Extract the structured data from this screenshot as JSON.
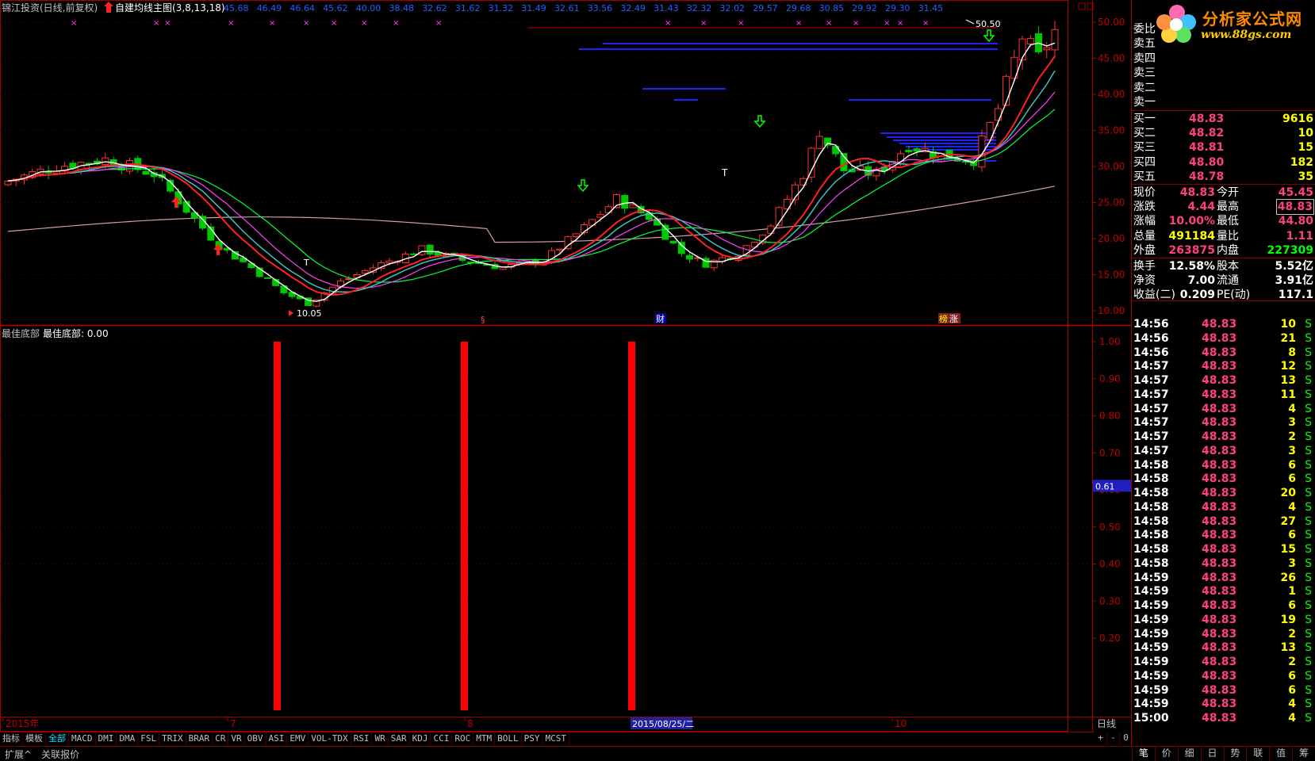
{
  "window": {
    "stock_title": "锦江投资(日线,前复权)",
    "indicator_title": "自建均线主图(3,8,13,18)",
    "ma_values": [
      "45.68",
      "46.49",
      "46.64",
      "45.62",
      "40.00",
      "38.48",
      "32.62",
      "31.62",
      "31.32",
      "31.49",
      "32.61",
      "33.56",
      "32.49",
      "31.43",
      "32.32",
      "32.02",
      "29.57",
      "29.68",
      "30.85",
      "29.92",
      "29.30",
      "31.45"
    ]
  },
  "main_chart": {
    "price_axis": [
      "50.00",
      "45.00",
      "40.00",
      "35.00",
      "30.00",
      "25.00",
      "20.00",
      "15.00",
      "10.00"
    ],
    "high_label": "50.50",
    "low_label": "10.05",
    "markers": {
      "s_mark": "§",
      "cai_mark": "财",
      "bang_mark": "榜",
      "zhang_mark": "涨",
      "t_mark": "T"
    },
    "colors": {
      "up": "#ff3232",
      "down": "#00c800",
      "ma3": "#ffffff",
      "ma8": "#ff2020",
      "ma13": "#ff40ff",
      "ma18": "#00ff40",
      "long_ma": "#d0a0a0",
      "cyan_ma": "#40c0c0"
    }
  },
  "sub_chart": {
    "title": "最佳底部",
    "value_label": "最佳底部: 0.00",
    "axis": [
      "1.00",
      "0.90",
      "0.80",
      "0.70",
      "0.60",
      "0.50",
      "0.40",
      "0.30",
      "0.20"
    ],
    "current_marker": "0.61",
    "signal_bars": 3
  },
  "time_axis": {
    "labels": [
      "2015年",
      "7",
      "8",
      "10"
    ],
    "cursor_date": "2015/08/25/二",
    "period": "日线"
  },
  "indicator_tabs": [
    "指标",
    "模板",
    "全部",
    "MACD",
    "DMI",
    "DMA",
    "FSL",
    "TRIX",
    "BRAR",
    "CR",
    "VR",
    "OBV",
    "ASI",
    "EMV",
    "VOL-TDX",
    "RSI",
    "WR",
    "SAR",
    "KDJ",
    "CCI",
    "ROC",
    "MTM",
    "BOLL",
    "PSY",
    "MCST"
  ],
  "tab_controls": [
    "+",
    "-",
    "0"
  ],
  "bottom_bar": [
    "扩展^",
    "关联报价"
  ],
  "logo": {
    "name": "分析家公式网",
    "url": "www.88gs.com"
  },
  "order_book": {
    "committee_label": "委比",
    "sells": [
      {
        "label": "卖五",
        "price": "",
        "vol": ""
      },
      {
        "label": "卖四",
        "price": "",
        "vol": ""
      },
      {
        "label": "卖三",
        "price": "",
        "vol": ""
      },
      {
        "label": "卖二",
        "price": "",
        "vol": ""
      },
      {
        "label": "卖一",
        "price": "",
        "vol": ""
      }
    ],
    "buys": [
      {
        "label": "买一",
        "price": "48.83",
        "vol": "9616"
      },
      {
        "label": "买二",
        "price": "48.82",
        "vol": "10"
      },
      {
        "label": "买三",
        "price": "48.81",
        "vol": "15"
      },
      {
        "label": "买四",
        "price": "48.80",
        "vol": "182"
      },
      {
        "label": "买五",
        "price": "48.78",
        "vol": "35"
      }
    ]
  },
  "quote": [
    {
      "l1": "现价",
      "v1": "48.83",
      "c1": "pink",
      "l2": "今开",
      "v2": "45.45",
      "c2": "pink"
    },
    {
      "l1": "涨跌",
      "v1": "4.44",
      "c1": "pink",
      "l2": "最高",
      "v2": "48.83",
      "c2": "pink"
    },
    {
      "l1": "涨幅",
      "v1": "10.00%",
      "c1": "pink",
      "l2": "最低",
      "v2": "44.80",
      "c2": "pink"
    },
    {
      "l1": "总量",
      "v1": "491184",
      "c1": "yellow",
      "l2": "量比",
      "v2": "1.11",
      "c2": "pink"
    },
    {
      "l1": "外盘",
      "v1": "263875",
      "c1": "pink",
      "l2": "内盘",
      "v2": "227309",
      "c2": "green"
    },
    {
      "l1": "换手",
      "v1": "12.58%",
      "c1": "white",
      "l2": "股本",
      "v2": "5.52亿",
      "c2": "white"
    },
    {
      "l1": "净资",
      "v1": "7.00",
      "c1": "white",
      "l2": "流通",
      "v2": "3.91亿",
      "c2": "white"
    },
    {
      "l1": "收益(二)",
      "v1": "0.209",
      "c1": "white",
      "l2": "PE(动)",
      "v2": "117.1",
      "c2": "white"
    }
  ],
  "ticks": [
    {
      "t": "14:56",
      "p": "48.83",
      "v": "10"
    },
    {
      "t": "14:56",
      "p": "48.83",
      "v": "21"
    },
    {
      "t": "14:56",
      "p": "48.83",
      "v": "8"
    },
    {
      "t": "14:57",
      "p": "48.83",
      "v": "12"
    },
    {
      "t": "14:57",
      "p": "48.83",
      "v": "13"
    },
    {
      "t": "14:57",
      "p": "48.83",
      "v": "11"
    },
    {
      "t": "14:57",
      "p": "48.83",
      "v": "4"
    },
    {
      "t": "14:57",
      "p": "48.83",
      "v": "3"
    },
    {
      "t": "14:57",
      "p": "48.83",
      "v": "2"
    },
    {
      "t": "14:57",
      "p": "48.83",
      "v": "3"
    },
    {
      "t": "14:58",
      "p": "48.83",
      "v": "6"
    },
    {
      "t": "14:58",
      "p": "48.83",
      "v": "6"
    },
    {
      "t": "14:58",
      "p": "48.83",
      "v": "20"
    },
    {
      "t": "14:58",
      "p": "48.83",
      "v": "4"
    },
    {
      "t": "14:58",
      "p": "48.83",
      "v": "27"
    },
    {
      "t": "14:58",
      "p": "48.83",
      "v": "6"
    },
    {
      "t": "14:58",
      "p": "48.83",
      "v": "15"
    },
    {
      "t": "14:58",
      "p": "48.83",
      "v": "3"
    },
    {
      "t": "14:59",
      "p": "48.83",
      "v": "26"
    },
    {
      "t": "14:59",
      "p": "48.83",
      "v": "1"
    },
    {
      "t": "14:59",
      "p": "48.83",
      "v": "6"
    },
    {
      "t": "14:59",
      "p": "48.83",
      "v": "19"
    },
    {
      "t": "14:59",
      "p": "48.83",
      "v": "2"
    },
    {
      "t": "14:59",
      "p": "48.83",
      "v": "13"
    },
    {
      "t": "14:59",
      "p": "48.83",
      "v": "2"
    },
    {
      "t": "14:59",
      "p": "48.83",
      "v": "6"
    },
    {
      "t": "14:59",
      "p": "48.83",
      "v": "6"
    },
    {
      "t": "14:59",
      "p": "48.83",
      "v": "4"
    },
    {
      "t": "15:00",
      "p": "48.83",
      "v": "4"
    }
  ],
  "tick_flag": "S",
  "side_tabs": [
    "笔",
    "价",
    "细",
    "日",
    "势",
    "联",
    "值",
    "筹"
  ]
}
